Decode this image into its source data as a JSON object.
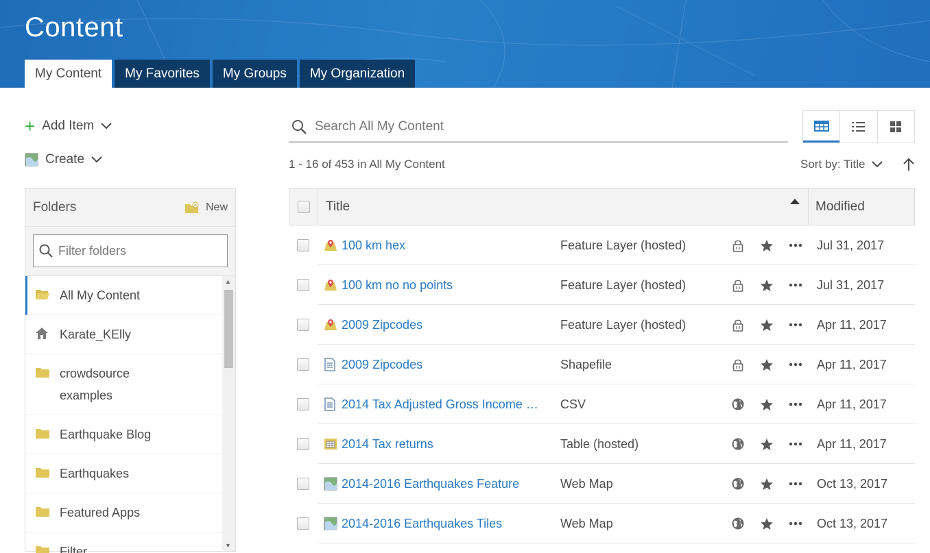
{
  "header": {
    "title": "Content",
    "tabs": [
      {
        "label": "My Content",
        "active": true
      },
      {
        "label": "My Favorites",
        "active": false
      },
      {
        "label": "My Groups",
        "active": false
      },
      {
        "label": "My Organization",
        "active": false
      }
    ]
  },
  "sidebar": {
    "add_item_label": "Add Item",
    "create_label": "Create",
    "folders_title": "Folders",
    "new_label": "New",
    "filter_placeholder": "Filter folders",
    "folders": [
      {
        "label": "All My Content",
        "icon": "open-folder-icon",
        "active": true
      },
      {
        "label": "Karate_KElly",
        "icon": "home-icon",
        "active": false
      },
      {
        "label": "crowdsource examples",
        "icon": "folder-icon",
        "active": false
      },
      {
        "label": "Earthquake Blog",
        "icon": "folder-icon",
        "active": false
      },
      {
        "label": "Earthquakes",
        "icon": "folder-icon",
        "active": false
      },
      {
        "label": "Featured Apps",
        "icon": "folder-icon",
        "active": false
      },
      {
        "label": "Filter",
        "icon": "folder-icon",
        "active": false
      }
    ]
  },
  "search": {
    "placeholder": "Search All My Content"
  },
  "results": {
    "count_text": "1 - 16 of 453 in All My Content",
    "sort_label": "Sort by: Title"
  },
  "table": {
    "col_title": "Title",
    "col_modified": "Modified",
    "rows": [
      {
        "title": "100 km hex",
        "type": "Feature Layer (hosted)",
        "icon": "feature-layer-icon",
        "sharing": "private-lock-icon",
        "modified": "Jul 31, 2017"
      },
      {
        "title": "100 km no no points",
        "type": "Feature Layer (hosted)",
        "icon": "feature-layer-icon",
        "sharing": "private-lock-icon",
        "modified": "Jul 31, 2017"
      },
      {
        "title": "2009 Zipcodes",
        "type": "Feature Layer (hosted)",
        "icon": "feature-layer-icon",
        "sharing": "private-lock-icon",
        "modified": "Apr 11, 2017"
      },
      {
        "title": "2009 Zipcodes",
        "type": "Shapefile",
        "icon": "document-icon",
        "sharing": "private-lock-icon",
        "modified": "Apr 11, 2017"
      },
      {
        "title": "2014 Tax Adjusted Gross Income …",
        "type": "CSV",
        "icon": "document-icon",
        "sharing": "public-globe-icon",
        "modified": "Apr 11, 2017"
      },
      {
        "title": "2014 Tax returns",
        "type": "Table (hosted)",
        "icon": "table-icon",
        "sharing": "public-globe-icon",
        "modified": "Apr 11, 2017"
      },
      {
        "title": "2014-2016 Earthquakes Feature",
        "type": "Web Map",
        "icon": "web-map-icon",
        "sharing": "public-globe-icon",
        "modified": "Oct 13, 2017"
      },
      {
        "title": "2014-2016 Earthquakes Tiles",
        "type": "Web Map",
        "icon": "web-map-icon",
        "sharing": "public-globe-icon",
        "modified": "Oct 13, 2017"
      }
    ]
  },
  "colors": {
    "accent": "#2b7bc4",
    "banner": "#1e6db8",
    "tab_dark": "#0e3a66",
    "add_green": "#35ac46",
    "folder_yellow": "#e0c65b"
  }
}
